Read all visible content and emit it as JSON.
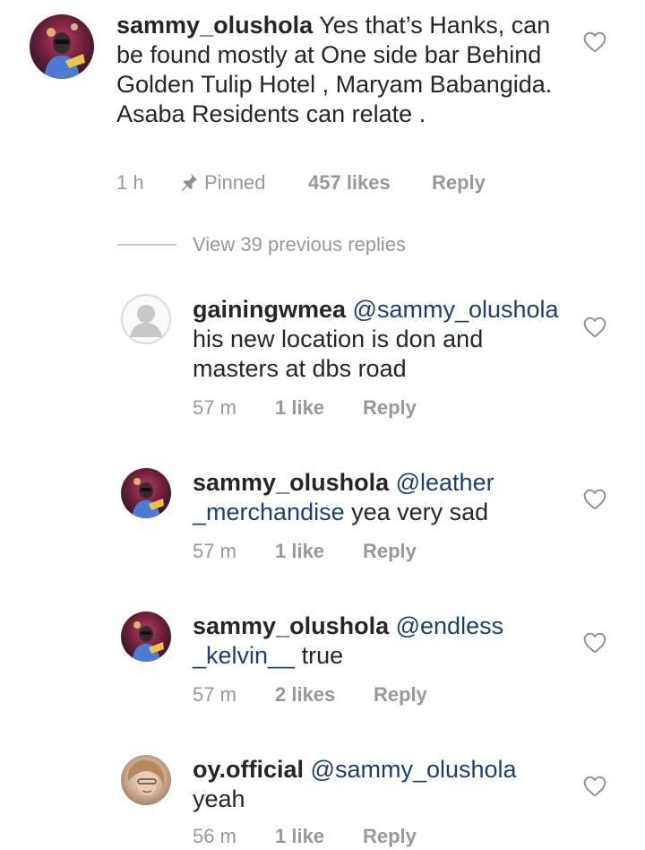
{
  "colors": {
    "text": "#262626",
    "meta": "#999999",
    "mention": "#1c3f6e",
    "divider": "#c7c7c7"
  },
  "main_comment": {
    "username": "sammy_olushola",
    "text": "Yes that’s Hanks, can be found mostly at One side bar Behind Golden Tulip Hotel , Maryam Babangida.  Asaba Residents can relate .",
    "time": "1 h",
    "pinned_label": "Pinned",
    "likes": "457 likes",
    "reply_label": "Reply",
    "pin_icon": "pin-icon",
    "like_icon": "heart-icon"
  },
  "view_replies": {
    "label": "View 39 previous replies"
  },
  "replies": [
    {
      "username": "gainingwmea",
      "mention": "@sammy_olushola",
      "text": "his new location is don and masters at dbs road",
      "time": "57 m",
      "likes": "1 like",
      "reply_label": "Reply",
      "avatar": "default-avatar"
    },
    {
      "username": "sammy_olushola",
      "mention": "@leather _merchandise",
      "text": "yea very sad",
      "time": "57 m",
      "likes": "1 like",
      "reply_label": "Reply",
      "avatar": "user-avatar"
    },
    {
      "username": "sammy_olushola",
      "mention": "@endless _kelvin__",
      "text": "true",
      "time": "57 m",
      "likes": "2 likes",
      "reply_label": "Reply",
      "avatar": "user-avatar"
    },
    {
      "username": "oy.official",
      "mention": "@sammy_olushola",
      "text": "yeah",
      "time": "56 m",
      "likes": "1 like",
      "reply_label": "Reply",
      "avatar": "user-avatar"
    }
  ]
}
